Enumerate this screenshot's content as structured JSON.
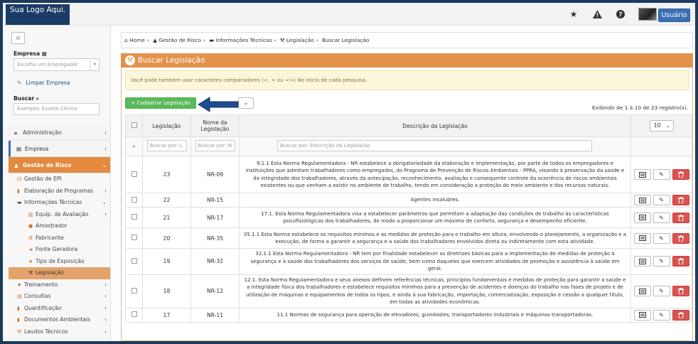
{
  "topbar": {
    "logo_text": "Sua Logo Aqui.",
    "user_label": "Usuário",
    "icons": [
      "star-icon",
      "warning-icon",
      "help-icon"
    ]
  },
  "sidebar": {
    "empresa_label": "Empresa",
    "empresa_placeholder": "Escolha um Empregador",
    "limpar_label": "Limpar Empresa",
    "buscar_label": "Buscar",
    "buscar_placeholder": "Exemplo: Exame Clínico",
    "menu": [
      {
        "label": "Administração",
        "icon": "lock-icon"
      },
      {
        "label": "Empresa",
        "icon": "building-icon"
      },
      {
        "label": "Gestão de Risco",
        "icon": "warning-icon"
      }
    ],
    "risk_items": [
      {
        "label": "Gestão de EPI",
        "icon": "headset-icon",
        "chevron": false
      },
      {
        "label": "Elaboração de Programas",
        "icon": "book-icon",
        "chevron": true
      },
      {
        "label": "Informações Técnicas",
        "icon": "folder-icon",
        "chevron": true
      }
    ],
    "tech_items": [
      {
        "label": "Equip. de Avaliação",
        "icon": "chart-icon"
      },
      {
        "label": "Amostrador",
        "icon": "circle-icon"
      },
      {
        "label": "Fabricante",
        "icon": "cogs-icon"
      },
      {
        "label": "Fonte Geradora",
        "icon": "bullhorn-icon"
      },
      {
        "label": "Tipo de Exposição",
        "icon": "star-icon"
      },
      {
        "label": "Legislação",
        "icon": "gavel-icon"
      }
    ],
    "bottom_items": [
      {
        "label": "Treinamento",
        "icon": "fire-icon"
      },
      {
        "label": "Consultas",
        "icon": "table-icon"
      },
      {
        "label": "Quantificação",
        "icon": "book-icon"
      },
      {
        "label": "Documentos Ambientais",
        "icon": "book-icon"
      },
      {
        "label": "Laudos Técnicos",
        "icon": "gavel-icon"
      }
    ]
  },
  "breadcrumb": [
    "Home",
    "Gestão de Risco",
    "Informações Técnicas",
    "Legislação",
    "Buscar Legislação"
  ],
  "panel": {
    "title": "Buscar Legislação",
    "alert": "Você pode também usar caracteres comparadores (<, > ou <>) No início de cada pesquisa.",
    "add_button": "+ Cadastrar Legislação",
    "showing": "Exibindo de 1 à 10 de 23 registro(s).",
    "page_size": "10"
  },
  "table": {
    "headers": {
      "legislacao": "Legislação",
      "nome": "Nome da Legislação",
      "descricao": "Descrição da Legislação"
    },
    "filters": {
      "legislacao": "Buscar por: L",
      "nome": "Buscar por: N",
      "descricao": "Buscar por: Descrição da Legislação"
    },
    "rows": [
      {
        "id": "23",
        "nome": "NR-09",
        "descricao": "9.1.1 Esta Norma Regulamentadora - NR estabelece a obrigatoriedade da elaboração e implementação, por parte de todos os empregadores e instituições que admitam trabalhadores como empregados, do Programa de Prevenção de Riscos Ambientais - PPRA, visando à preservação da saúde e da integridade dos trabalhadores, através da antecipação, reconhecimento, avaliação e consequente controle da ocorrência de riscos ambientais existentes ou que venham a existir no ambiente de trabalho, tendo em consideração a proteção do meio ambiente e dos recursos naturais."
      },
      {
        "id": "22",
        "nome": "NR-15",
        "descricao": "Agentes insalubres."
      },
      {
        "id": "21",
        "nome": "NR-17",
        "descricao": "17.1. Esta Norma Regulamentadora visa a estabelecer parâmetros que permitam a adaptação das condições de trabalho às características psicofisiológicas dos trabalhadores, de modo a proporcionar um máximo de conforto, segurança e desempenho eficiente."
      },
      {
        "id": "20",
        "nome": "NR-35",
        "descricao": "35.1.1 Esta Norma estabelece os requisitos mínimos e as medidas de proteção para o trabalho em altura, envolvendo o planejamento, a organização e a execução, de forma a garantir a segurança e a saúde dos trabalhadores envolvidos direta ou indiretamente com esta atividade."
      },
      {
        "id": "19",
        "nome": "NR-32",
        "descricao": "32.1.1 Esta Norma Regulamentadora - NR tem por finalidade estabelecer as diretrizes básicas para a implementação de medidas de proteção à segurança e à saúde dos trabalhadores dos serviços de saúde, bem como daqueles que exercem atividades de promoção e assistência à saúde em geral."
      },
      {
        "id": "18",
        "nome": "NR-12",
        "descricao": "12.1. Esta Norma Regulamentadora e seus anexos definem referências técnicas, princípios fundamentais e medidas de proteção para garantir a saúde e a integridade física dos trabalhadores e estabelece requisitos mínimos para a prevenção de acidentes e doenças do trabalho nas fases de projeto e de utilização de máquinas e equipamentos de todos os tipos, e ainda à sua fabricação, importação, comercialização, exposição e cessão a qualquer título, em todas as atividades econômicas."
      },
      {
        "id": "17",
        "nome": "NR-11",
        "descricao": "11.1 Normas de segurança para operação de elevadores, guindastes, transportadores industriais e máquinas transportadoras."
      }
    ]
  },
  "colors": {
    "accent": "#e3924a",
    "brand": "#1a3c66",
    "success": "#5cb85c",
    "danger": "#d9534f",
    "user_button": "#3a6fb4"
  }
}
